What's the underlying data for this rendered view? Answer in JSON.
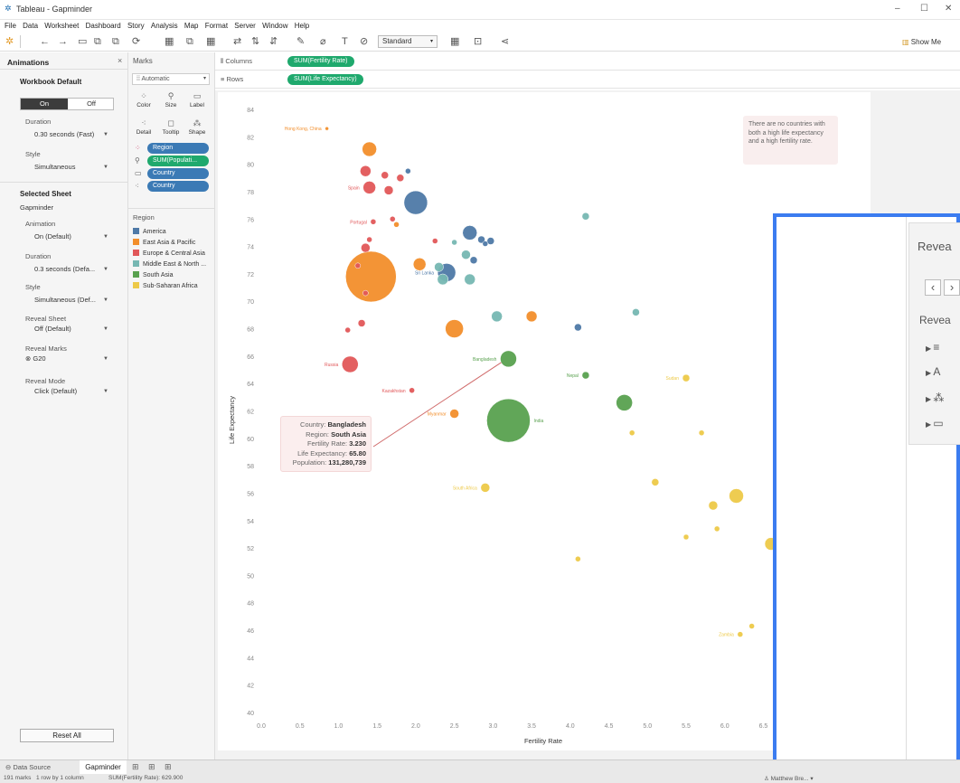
{
  "window": {
    "title": "Tableau - Gapminder",
    "min": "–",
    "max": "☐",
    "close": "✕"
  },
  "menu": [
    "File",
    "Data",
    "Worksheet",
    "Dashboard",
    "Story",
    "Analysis",
    "Map",
    "Format",
    "Server",
    "Window",
    "Help"
  ],
  "toolbar": {
    "standard": "Standard",
    "show_me": "Show Me"
  },
  "left": {
    "title": "Animations",
    "workbook_default": "Workbook Default",
    "on": "On",
    "off": "Off",
    "duration_label": "Duration",
    "duration_value": "0.30 seconds (Fast)",
    "style_label": "Style",
    "style_value": "Simultaneous",
    "selected_sheet": "Selected Sheet",
    "sheet_name": "Gapminder",
    "animation_label": "Animation",
    "animation_value": "On (Default)",
    "duration2_label": "Duration",
    "duration2_value": "0.3 seconds (Defa...",
    "style2_label": "Style",
    "style2_value": "Simultaneous (Def...",
    "reveal_sheet_label": "Reveal Sheet",
    "reveal_sheet_value": "Off (Default)",
    "reveal_marks_label": "Reveal Marks",
    "reveal_marks_value": "G20",
    "reveal_mode_label": "Reveal Mode",
    "reveal_mode_value": "Click (Default)",
    "reset_all": "Reset All"
  },
  "marks": {
    "title": "Marks",
    "mark_type": "Automatic",
    "buttons": [
      "Color",
      "Size",
      "Label",
      "Detail",
      "Tooltip",
      "Shape"
    ],
    "pills": [
      "Region",
      "SUM(Populati...",
      "Country",
      "Country"
    ],
    "legend_title": "Region",
    "legend": [
      {
        "name": "America",
        "color": "#4e79a7"
      },
      {
        "name": "East Asia & Pacific",
        "color": "#f28e2b"
      },
      {
        "name": "Europe & Central Asia",
        "color": "#e15759"
      },
      {
        "name": "Middle East & North ...",
        "color": "#76b7b2"
      },
      {
        "name": "South Asia",
        "color": "#59a14f"
      },
      {
        "name": "Sub-Saharan Africa",
        "color": "#edc948"
      }
    ]
  },
  "shelves": {
    "columns_label": "Columns",
    "columns_pill": "SUM(Fertility Rate)",
    "rows_label": "Rows",
    "rows_pill": "SUM(Life Expectancy)"
  },
  "tooltip": {
    "country_label": "Country:",
    "country": "Bangladesh",
    "region_label": "Region:",
    "region": "South Asia",
    "fertility_label": "Fertility Rate:",
    "fertility": "3.230",
    "life_label": "Life Expectancy:",
    "life": "65.80",
    "pop_label": "Population:",
    "pop": "131,280,739"
  },
  "annotation": "There are no countries with both a high life expectancy and a high fertility rate.",
  "reveal_panel": {
    "title": "Revea",
    "subtitle": "Revea",
    "rows": [
      "≡",
      "A",
      "⁂",
      "▭"
    ]
  },
  "tabs": {
    "data_source": "Data Source",
    "sheet": "Gapminder"
  },
  "status": {
    "marks": "191 marks",
    "rows": "1 row by 1 column",
    "sum": "SUM(Fertility Rate): 629.900",
    "user": "Matthew Bre..."
  },
  "chart_data": {
    "type": "scatter",
    "xlabel": "Fertility Rate",
    "ylabel": "Life Expectancy",
    "xlim": [
      0.0,
      6.6
    ],
    "ylim": [
      40,
      84
    ],
    "xticks": [
      "0.0",
      "0.5",
      "1.0",
      "1.5",
      "2.0",
      "2.5",
      "3.0",
      "3.5",
      "4.0",
      "4.5",
      "5.0",
      "5.5",
      "6.0",
      "6.5"
    ],
    "yticks": [
      "40",
      "42",
      "44",
      "46",
      "48",
      "50",
      "52",
      "54",
      "56",
      "58",
      "60",
      "62",
      "64",
      "66",
      "68",
      "70",
      "72",
      "74",
      "76",
      "78",
      "80",
      "82",
      "84"
    ],
    "region_colors": {
      "America": "#4e79a7",
      "East Asia & Pacific": "#f28e2b",
      "Europe & Central Asia": "#e15759",
      "Middle East & North Africa": "#76b7b2",
      "South Asia": "#59a14f",
      "Sub-Saharan Africa": "#edc948"
    },
    "points": [
      {
        "x": 0.85,
        "y": 82.6,
        "r": 2,
        "region": "East Asia & Pacific",
        "label": "Hong Kong, China"
      },
      {
        "x": 1.4,
        "y": 81.1,
        "r": 8,
        "region": "East Asia & Pacific"
      },
      {
        "x": 1.35,
        "y": 79.5,
        "r": 6,
        "region": "Europe & Central Asia"
      },
      {
        "x": 1.6,
        "y": 79.2,
        "r": 4,
        "region": "Europe & Central Asia"
      },
      {
        "x": 1.8,
        "y": 79.0,
        "r": 4,
        "region": "Europe & Central Asia"
      },
      {
        "x": 1.9,
        "y": 79.5,
        "r": 3,
        "region": "America"
      },
      {
        "x": 1.4,
        "y": 78.3,
        "r": 7,
        "region": "Europe & Central Asia",
        "label": "Spain"
      },
      {
        "x": 1.65,
        "y": 78.1,
        "r": 5,
        "region": "Europe & Central Asia"
      },
      {
        "x": 2.0,
        "y": 77.2,
        "r": 13,
        "region": "America"
      },
      {
        "x": 1.7,
        "y": 76.0,
        "r": 3,
        "region": "Europe & Central Asia"
      },
      {
        "x": 1.45,
        "y": 75.8,
        "r": 3,
        "region": "Europe & Central Asia",
        "label": "Portugal"
      },
      {
        "x": 1.75,
        "y": 75.6,
        "r": 3,
        "region": "East Asia & Pacific"
      },
      {
        "x": 1.4,
        "y": 74.5,
        "r": 3,
        "region": "Europe & Central Asia"
      },
      {
        "x": 2.25,
        "y": 74.4,
        "r": 3,
        "region": "Europe & Central Asia"
      },
      {
        "x": 2.7,
        "y": 75.0,
        "r": 8,
        "region": "America"
      },
      {
        "x": 2.5,
        "y": 74.3,
        "r": 3,
        "region": "Middle East & North Africa"
      },
      {
        "x": 2.9,
        "y": 74.2,
        "r": 3,
        "region": "America"
      },
      {
        "x": 2.85,
        "y": 74.5,
        "r": 4,
        "region": "America"
      },
      {
        "x": 2.97,
        "y": 74.4,
        "r": 4,
        "region": "America"
      },
      {
        "x": 4.2,
        "y": 76.2,
        "r": 4,
        "region": "Middle East & North Africa"
      },
      {
        "x": 1.35,
        "y": 73.9,
        "r": 5,
        "region": "Europe & Central Asia"
      },
      {
        "x": 1.25,
        "y": 72.6,
        "r": 3,
        "region": "Europe & Central Asia"
      },
      {
        "x": 1.42,
        "y": 71.8,
        "r": 28,
        "region": "East Asia & Pacific"
      },
      {
        "x": 2.05,
        "y": 72.7,
        "r": 7,
        "region": "East Asia & Pacific"
      },
      {
        "x": 2.3,
        "y": 72.5,
        "r": 5,
        "region": "Middle East & North Africa"
      },
      {
        "x": 2.4,
        "y": 72.1,
        "r": 10,
        "region": "America",
        "label": "Sri Lanka"
      },
      {
        "x": 2.35,
        "y": 71.6,
        "r": 6,
        "region": "Middle East & North Africa"
      },
      {
        "x": 2.7,
        "y": 71.6,
        "r": 6,
        "region": "Middle East & North Africa"
      },
      {
        "x": 2.65,
        "y": 73.4,
        "r": 5,
        "region": "Middle East & North Africa"
      },
      {
        "x": 2.75,
        "y": 73.0,
        "r": 4,
        "region": "America"
      },
      {
        "x": 1.35,
        "y": 70.6,
        "r": 3,
        "region": "Europe & Central Asia"
      },
      {
        "x": 1.3,
        "y": 68.4,
        "r": 4,
        "region": "Europe & Central Asia"
      },
      {
        "x": 1.12,
        "y": 67.9,
        "r": 3,
        "region": "Europe & Central Asia"
      },
      {
        "x": 2.5,
        "y": 68.0,
        "r": 10,
        "region": "East Asia & Pacific"
      },
      {
        "x": 3.05,
        "y": 68.9,
        "r": 6,
        "region": "Middle East & North Africa"
      },
      {
        "x": 3.5,
        "y": 68.9,
        "r": 6,
        "region": "East Asia & Pacific"
      },
      {
        "x": 4.1,
        "y": 68.1,
        "r": 4,
        "region": "America"
      },
      {
        "x": 4.85,
        "y": 69.2,
        "r": 4,
        "region": "Middle East & North Africa"
      },
      {
        "x": 3.2,
        "y": 65.8,
        "r": 9,
        "region": "South Asia",
        "label": "Bangladesh"
      },
      {
        "x": 1.15,
        "y": 65.4,
        "r": 9,
        "region": "Europe & Central Asia",
        "label": "Russia"
      },
      {
        "x": 4.2,
        "y": 64.6,
        "r": 4,
        "region": "South Asia",
        "label": "Nepal"
      },
      {
        "x": 1.95,
        "y": 63.5,
        "r": 3,
        "region": "Europe & Central Asia",
        "label": "Kazakhstan"
      },
      {
        "x": 4.7,
        "y": 62.6,
        "r": 9,
        "region": "South Asia"
      },
      {
        "x": 3.2,
        "y": 61.3,
        "r": 24,
        "region": "South Asia",
        "label": "India"
      },
      {
        "x": 2.5,
        "y": 61.8,
        "r": 5,
        "region": "East Asia & Pacific",
        "label": "Myanmar"
      },
      {
        "x": 4.8,
        "y": 60.4,
        "r": 3,
        "region": "Sub-Saharan Africa"
      },
      {
        "x": 5.5,
        "y": 64.4,
        "r": 4,
        "region": "Sub-Saharan Africa",
        "label": "Sudan"
      },
      {
        "x": 2.9,
        "y": 56.4,
        "r": 5,
        "region": "Sub-Saharan Africa",
        "label": "South Africa"
      },
      {
        "x": 5.1,
        "y": 56.8,
        "r": 4,
        "region": "Sub-Saharan Africa"
      },
      {
        "x": 5.7,
        "y": 60.4,
        "r": 3,
        "region": "Sub-Saharan Africa"
      },
      {
        "x": 6.15,
        "y": 55.8,
        "r": 8,
        "region": "Sub-Saharan Africa"
      },
      {
        "x": 5.85,
        "y": 55.1,
        "r": 5,
        "region": "Sub-Saharan Africa"
      },
      {
        "x": 5.9,
        "y": 53.4,
        "r": 3,
        "region": "Sub-Saharan Africa"
      },
      {
        "x": 6.6,
        "y": 52.3,
        "r": 7,
        "region": "Sub-Saharan Africa"
      },
      {
        "x": 5.5,
        "y": 52.8,
        "r": 3,
        "region": "Sub-Saharan Africa"
      },
      {
        "x": 4.1,
        "y": 51.2,
        "r": 3,
        "region": "Sub-Saharan Africa"
      },
      {
        "x": 6.35,
        "y": 46.3,
        "r": 3,
        "region": "Sub-Saharan Africa"
      },
      {
        "x": 6.2,
        "y": 45.7,
        "r": 3,
        "region": "Sub-Saharan Africa",
        "label": "Zambia"
      }
    ],
    "annotation": {
      "to": {
        "x": 3.2,
        "y": 65.8
      }
    }
  }
}
